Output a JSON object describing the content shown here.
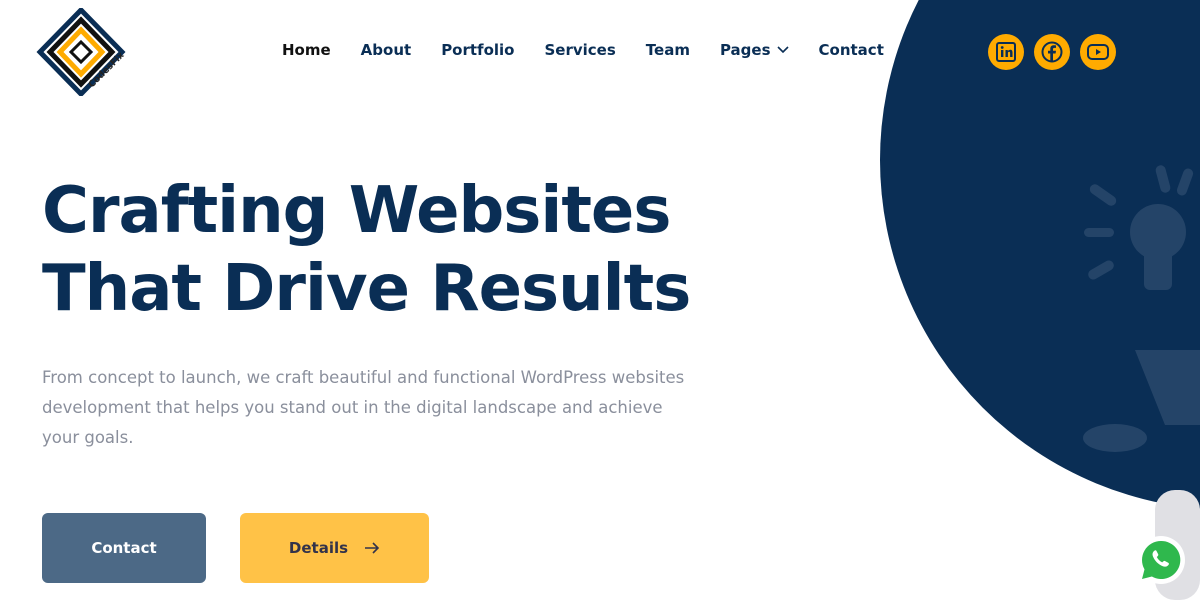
{
  "brand": {
    "name": "CodesFix"
  },
  "nav": {
    "items": [
      {
        "label": "Home"
      },
      {
        "label": "About"
      },
      {
        "label": "Portfolio"
      },
      {
        "label": "Services"
      },
      {
        "label": "Team"
      },
      {
        "label": "Pages"
      },
      {
        "label": "Contact"
      }
    ]
  },
  "social": [
    "linkedin-icon",
    "facebook-icon",
    "youtube-icon"
  ],
  "hero": {
    "title_line1": "Crafting Websites",
    "title_line2": "That Drive Results",
    "description": "From concept to launch, we craft beautiful and functional WordPress websites development that helps you stand out in the digital landscape and achieve your goals.",
    "primary_label": "Contact",
    "secondary_label": "Details"
  },
  "colors": {
    "navy": "#0a2e55",
    "accent": "#ffab00",
    "button_primary": "#4c6986",
    "button_secondary": "#ffc247"
  }
}
